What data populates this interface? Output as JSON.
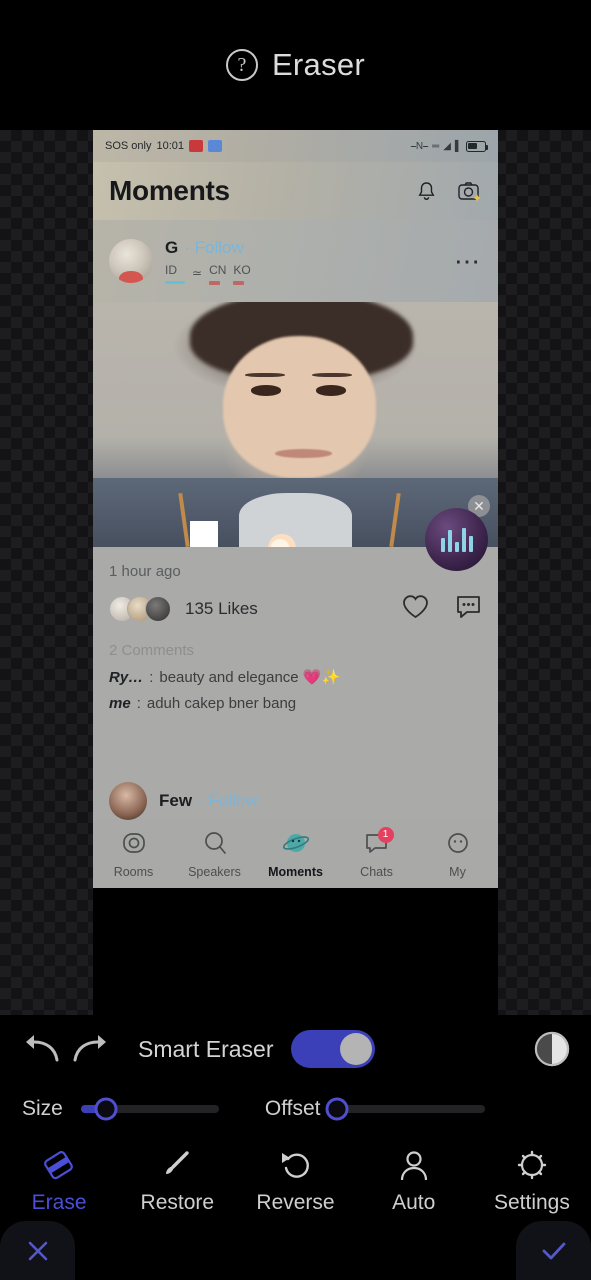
{
  "topbar": {
    "help_icon": "help-circle-icon",
    "title": "Eraser"
  },
  "screenshot": {
    "status_bar": {
      "carrier": "SOS only",
      "time": "10:01",
      "icons": [
        "nfc-icon",
        "vibrate-icon",
        "wifi-icon",
        "signal-icon",
        "battery-icon"
      ]
    },
    "header": {
      "title": "Moments",
      "bell_icon": "bell-icon",
      "camera_icon": "camera-add-icon"
    },
    "post": {
      "author": "G",
      "follow_label": "· Follow",
      "id_label": "ID",
      "country_label": "CN",
      "country_label2": "KO",
      "more_icon": "more-options-icon",
      "timestamp": "1 hour ago",
      "likes": "135 Likes",
      "like_icon": "heart-icon",
      "comment_icon": "comment-icon",
      "comments_count": "2 Comments",
      "comments": [
        {
          "author": "Ry…",
          "sep": ":",
          "text": "beauty and elegance 💗✨"
        },
        {
          "author": "me",
          "sep": ":",
          "text": "aduh cakep bner bang"
        }
      ]
    },
    "next_post": {
      "author": "Few",
      "follow_label": "· Follow"
    },
    "floating_widget": {
      "close_icon": "close-icon",
      "name": "floating-avatar-widget"
    },
    "bottom_nav": [
      {
        "label": "Rooms",
        "icon": "rooms-icon",
        "active": false,
        "badge": ""
      },
      {
        "label": "Speakers",
        "icon": "search-icon",
        "active": false,
        "badge": ""
      },
      {
        "label": "Moments",
        "icon": "planet-icon",
        "active": true,
        "badge": ""
      },
      {
        "label": "Chats",
        "icon": "chat-icon",
        "active": false,
        "badge": "1"
      },
      {
        "label": "My",
        "icon": "face-icon",
        "active": false,
        "badge": ""
      }
    ]
  },
  "controls": {
    "undo_icon": "undo-icon",
    "redo_icon": "redo-icon",
    "smart_eraser_label": "Smart Eraser",
    "smart_eraser_on": true,
    "contrast_icon": "contrast-icon",
    "size_label": "Size",
    "size_percent": 18,
    "offset_label": "Offset",
    "offset_percent": 0
  },
  "tools": [
    {
      "label": "Erase",
      "icon": "eraser-icon",
      "active": true
    },
    {
      "label": "Restore",
      "icon": "brush-icon",
      "active": false
    },
    {
      "label": "Reverse",
      "icon": "reverse-icon",
      "active": false
    },
    {
      "label": "Auto",
      "icon": "person-icon",
      "active": false
    },
    {
      "label": "Settings",
      "icon": "gear-icon",
      "active": false
    }
  ],
  "footer": {
    "cancel_icon": "close-icon",
    "confirm_icon": "check-icon"
  },
  "colors": {
    "accent": "#3c40b8",
    "accent_light": "#4b4fd8",
    "background": "#000000",
    "badge": "#e2425f"
  }
}
